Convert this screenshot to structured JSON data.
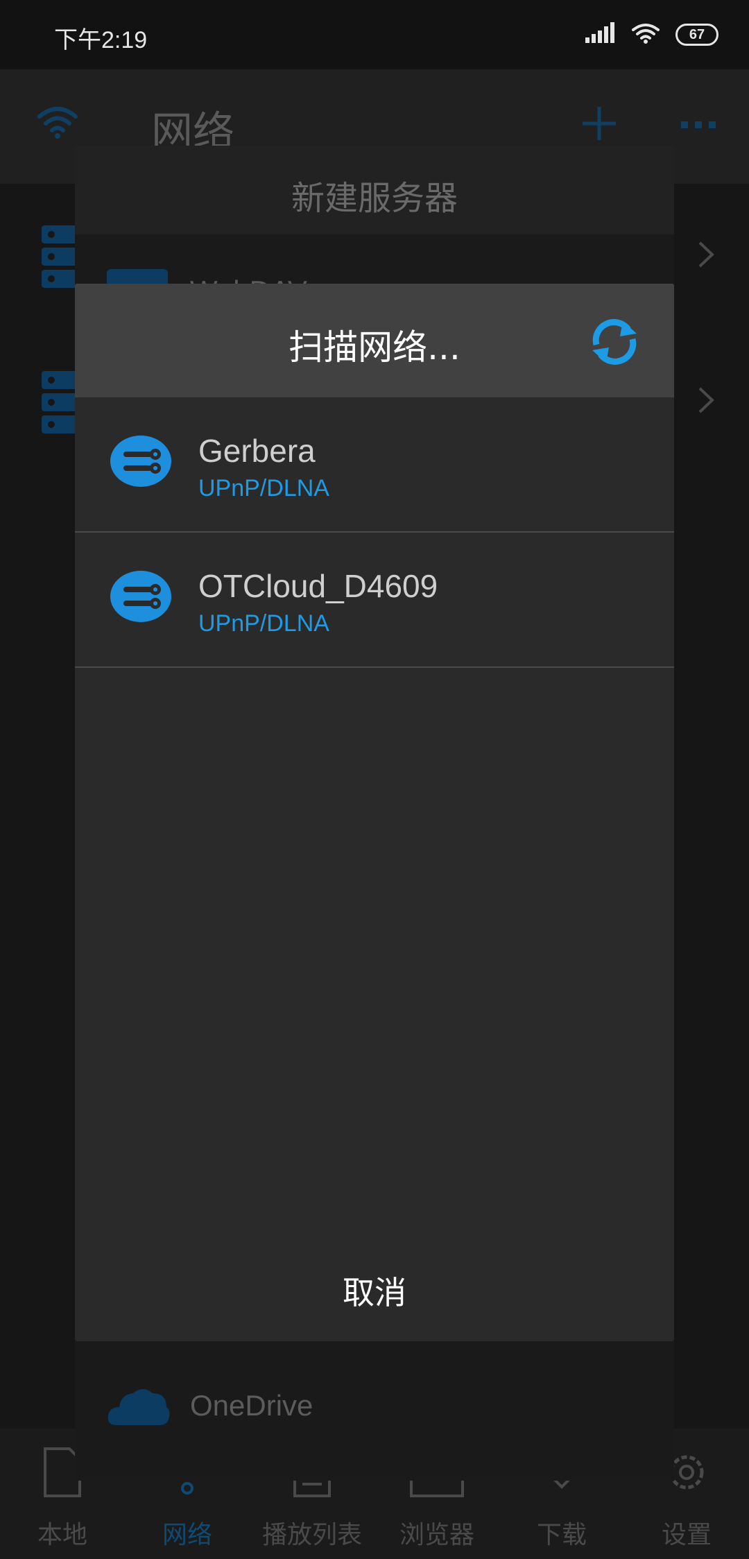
{
  "status_bar": {
    "time": "下午2:19",
    "battery": "67"
  },
  "app": {
    "title": "网络"
  },
  "server_dialog": {
    "title": "新建服务器",
    "items": [
      {
        "label": "WebDAV"
      },
      {
        "label": "OneDrive"
      }
    ]
  },
  "scan_dialog": {
    "title": "扫描网络...",
    "devices": [
      {
        "name": "Gerbera",
        "type": "UPnP/DLNA"
      },
      {
        "name": "OTCloud_D4609",
        "type": "UPnP/DLNA"
      }
    ],
    "cancel_label": "取消"
  },
  "bottom_nav": [
    {
      "label": "本地",
      "icon": "file-icon"
    },
    {
      "label": "网络",
      "icon": "network-icon",
      "active": true
    },
    {
      "label": "播放列表",
      "icon": "playlist-icon"
    },
    {
      "label": "浏览器",
      "icon": "browser-icon"
    },
    {
      "label": "下载",
      "icon": "download-icon"
    },
    {
      "label": "设置",
      "icon": "gear-icon"
    }
  ],
  "colors": {
    "accent": "#1d9be4",
    "dialog_bg": "#2a2a2a",
    "dialog_header": "#414141"
  }
}
